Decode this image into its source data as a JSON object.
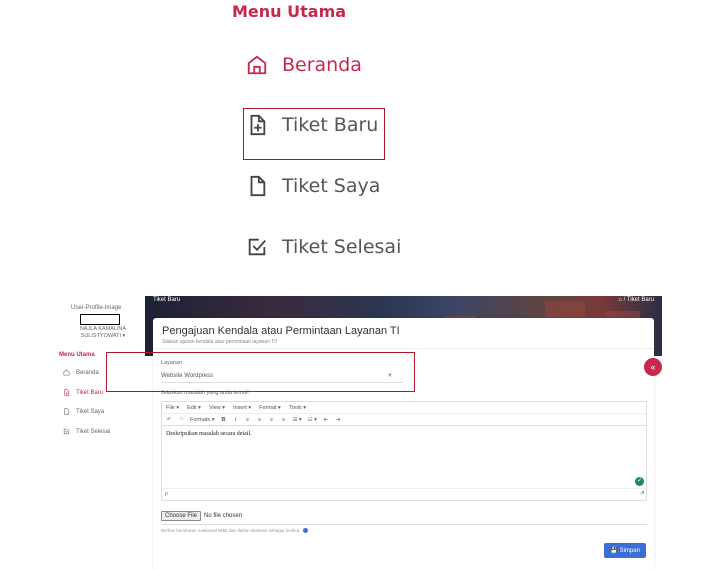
{
  "zoom_menu": {
    "title": "Menu Utama",
    "items": [
      {
        "label": "Beranda",
        "icon": "home-icon",
        "active": true
      },
      {
        "label": "Tiket Baru",
        "icon": "file-plus-icon",
        "active": false
      },
      {
        "label": "Tiket Saya",
        "icon": "file-icon",
        "active": false
      },
      {
        "label": "Tiket Selesai",
        "icon": "check-square-icon",
        "active": false
      }
    ]
  },
  "sidebar": {
    "profile_image_alt": "User-Profile-Image",
    "user_name": "NAJLA KAMALINA SULISTYOWATI ▾",
    "menu_title": "Menu Utama",
    "items": [
      {
        "label": "Beranda",
        "icon": "home-icon"
      },
      {
        "label": "Tiket Baru",
        "icon": "file-plus-icon"
      },
      {
        "label": "Tiket Saya",
        "icon": "file-icon"
      },
      {
        "label": "Tiket Selesai",
        "icon": "check-square-icon"
      }
    ]
  },
  "banner": {
    "title": "Tiket Baru",
    "breadcrumb": "⌂ / Tiket Baru"
  },
  "form": {
    "title": "Pengajuan Kendala atau Permintaan Layanan TI",
    "subtitle": "Silakan ajukan kendala atau permintaan layanan TI!",
    "layanan_label": "Layanan",
    "layanan_value": "Website Wordpress",
    "masalah_label": "Jelaskan masalah yang anda temui!",
    "editor_menu": [
      "File ▾",
      "Edit ▾",
      "View ▾",
      "Insert ▾",
      "Format ▾",
      "Tools ▾"
    ],
    "editor_toolbar": [
      "↶",
      "↷",
      "Formats ▾",
      "B",
      "I",
      "≡",
      "≡",
      "≡",
      "≡",
      "☰ ▾",
      "☷ ▾",
      "⇤",
      "⇥"
    ],
    "editor_content": "Deskripsikan masalah secara detail.",
    "editor_status": "p",
    "file_button": "Choose File",
    "file_status": "No file chosen",
    "file_note": "Berkas berukuran maksimal 5MB dan dalam ekstensi sebagai berikut.",
    "save_label": "Simpan"
  },
  "colors": {
    "accent": "#c6284e",
    "highlight_box": "#b0162a",
    "primary_button": "#3a6fd8"
  }
}
